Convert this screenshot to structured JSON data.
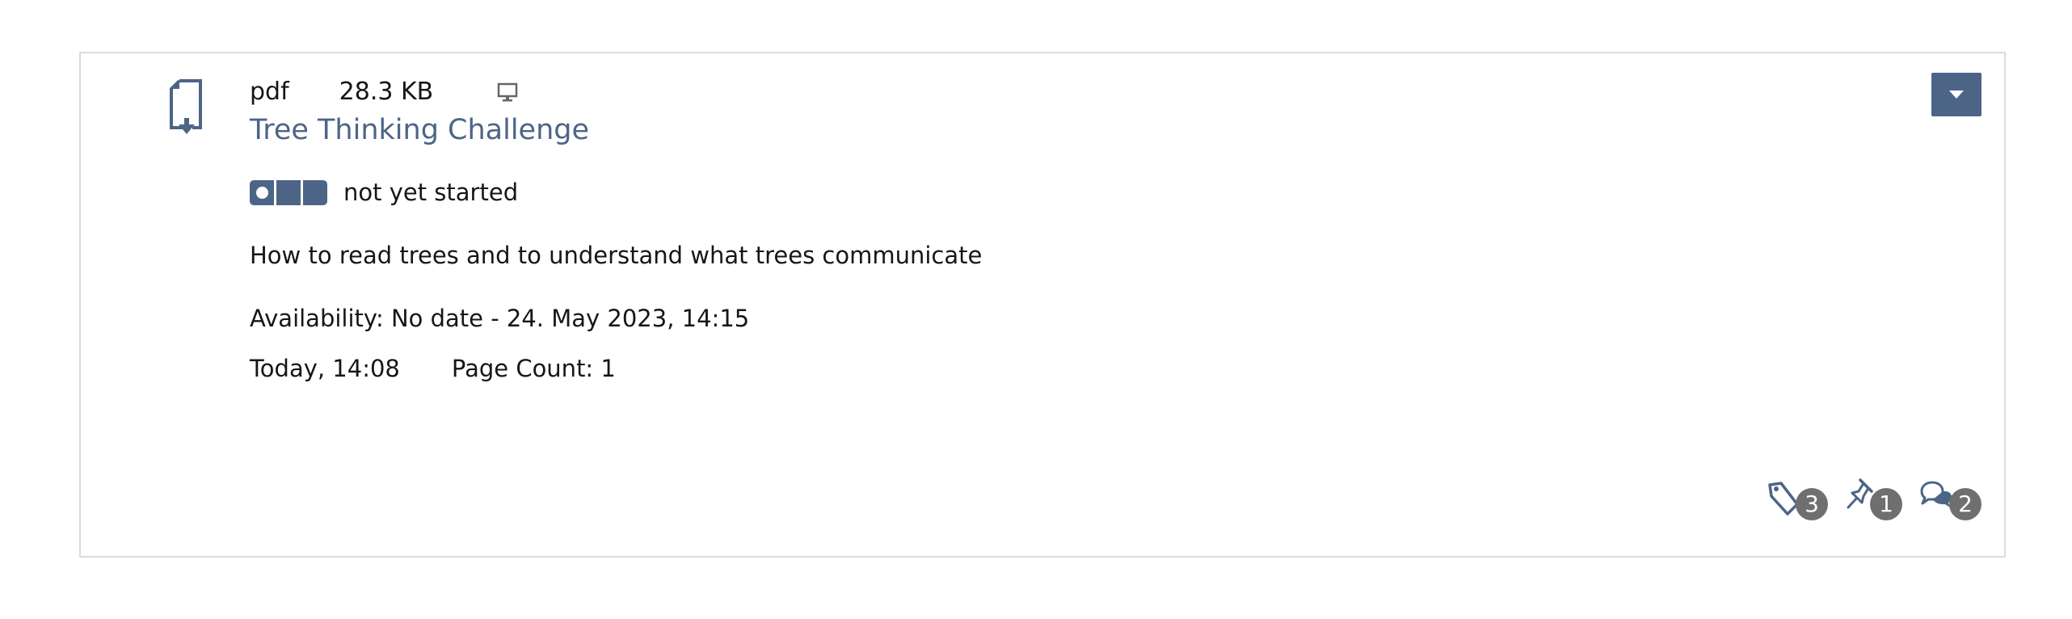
{
  "item": {
    "file_type": "pdf",
    "file_size": "28.3 KB",
    "offline_icon": "monitor-icon",
    "title": "Tree Thinking Challenge",
    "status_text": "not yet started",
    "description": "How to read trees and to understand what trees communicate",
    "availability": "Availability: No date - 24. May 2023, 14:15",
    "last_update": "Today, 14:08",
    "page_count": "Page Count: 1"
  },
  "actions": {
    "tags_count": "3",
    "notes_count": "1",
    "comments_count": "2"
  },
  "colors": {
    "accent": "#4c6586",
    "badge": "#6f6f6f",
    "border": "#dcdcdc"
  }
}
